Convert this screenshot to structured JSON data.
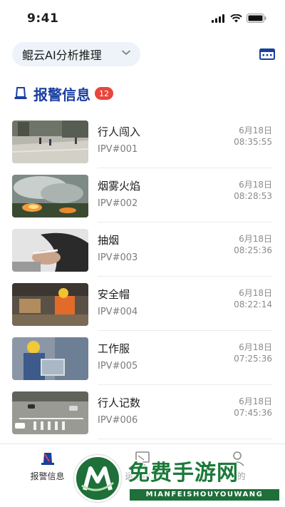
{
  "status_bar": {
    "time": "9:41"
  },
  "header": {
    "model_selector": "鲲云AI分析推理",
    "settings_icon": "keyboard-icon"
  },
  "section": {
    "title": "报警信息",
    "badge": "12"
  },
  "alerts": [
    {
      "type": "行人闯入",
      "camera": "IPV#001",
      "date": "6月18日",
      "time": "08:35:55"
    },
    {
      "type": "烟雾火焰",
      "camera": "IPV#002",
      "date": "6月18日",
      "time": "08:28:53"
    },
    {
      "type": "抽烟",
      "camera": "IPV#003",
      "date": "6月18日",
      "time": "08:25:36"
    },
    {
      "type": "安全帽",
      "camera": "IPV#004",
      "date": "6月18日",
      "time": "08:22:14"
    },
    {
      "type": "工作服",
      "camera": "IPV#005",
      "date": "6月18日",
      "time": "07:25:36"
    },
    {
      "type": "行人记数",
      "camera": "IPV#006",
      "date": "6月18日",
      "time": "07:45:36"
    }
  ],
  "tabs": [
    {
      "label": "报警信息",
      "icon": "alarm-icon"
    },
    {
      "label": "运营信息",
      "icon": "monitor-icon"
    },
    {
      "label": "我的",
      "icon": "user-icon"
    }
  ],
  "watermark": {
    "title": "免费手游网",
    "subtitle": "MIANFEISHOUYOUWANG"
  },
  "colors": {
    "accent": "#1a3fa0",
    "badge": "#e8453c",
    "watermark": "#1e6f3a"
  }
}
